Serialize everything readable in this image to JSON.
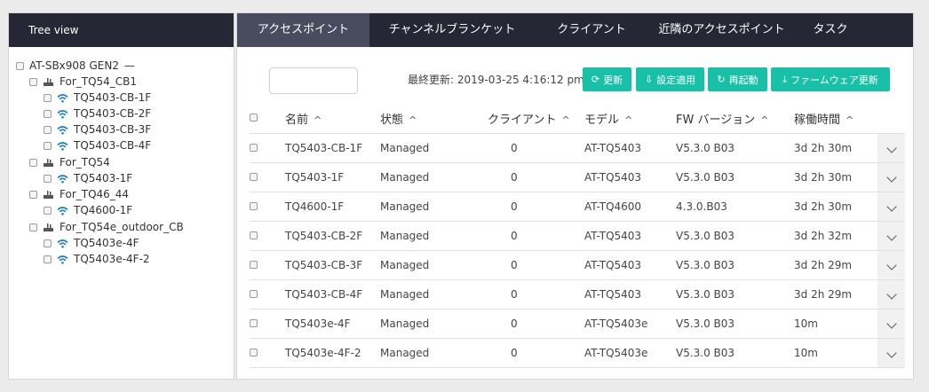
{
  "tree_panel": {
    "title": "Tree view",
    "nodes": [
      {
        "label": "AT-SBx908 GEN2",
        "suffix": "—",
        "type": "root"
      },
      {
        "label": "For_TQ54_CB1",
        "type": "switch"
      },
      {
        "label": "TQ5403-CB-1F",
        "type": "ap"
      },
      {
        "label": "TQ5403-CB-2F",
        "type": "ap"
      },
      {
        "label": "TQ5403-CB-3F",
        "type": "ap"
      },
      {
        "label": "TQ5403-CB-4F",
        "type": "ap"
      },
      {
        "label": "For_TQ54",
        "type": "switch"
      },
      {
        "label": "TQ5403-1F",
        "type": "ap"
      },
      {
        "label": "For_TQ46_44",
        "type": "switch"
      },
      {
        "label": "TQ4600-1F",
        "type": "ap"
      },
      {
        "label": "For_TQ54e_outdoor_CB",
        "type": "switch"
      },
      {
        "label": "TQ5403e-4F",
        "type": "ap"
      },
      {
        "label": "TQ5403e-4F-2",
        "type": "ap"
      }
    ]
  },
  "tabs": [
    {
      "label": "アクセスポイント",
      "active": true
    },
    {
      "label": "チャンネルブランケット",
      "active": false
    },
    {
      "label": "クライアント",
      "active": false
    },
    {
      "label": "近隣のアクセスポイント",
      "active": false
    },
    {
      "label": "タスク",
      "active": false
    }
  ],
  "toolbar": {
    "search_value": "",
    "last_updated": "最終更新: 2019-03-25 4:16:12 pm",
    "buttons": {
      "refresh": "更新",
      "apply_settings": "設定適用",
      "reboot": "再起動",
      "firmware_update": "ファームウェア更新"
    }
  },
  "table": {
    "columns": [
      "名前",
      "状態",
      "クライアント",
      "モデル",
      "FW バージョン",
      "稼働時間"
    ],
    "sort_indicator": "^",
    "rows": [
      {
        "name": "TQ5403-CB-1F",
        "status": "Managed",
        "clients": "0",
        "model": "AT-TQ5403",
        "fw": "V5.3.0 B03",
        "uptime": "3d 2h 30m"
      },
      {
        "name": "TQ5403-1F",
        "status": "Managed",
        "clients": "0",
        "model": "AT-TQ5403",
        "fw": "V5.3.0 B03",
        "uptime": "3d 2h 30m"
      },
      {
        "name": "TQ4600-1F",
        "status": "Managed",
        "clients": "0",
        "model": "AT-TQ4600",
        "fw": "4.3.0.B03",
        "uptime": "3d 2h 30m"
      },
      {
        "name": "TQ5403-CB-2F",
        "status": "Managed",
        "clients": "0",
        "model": "AT-TQ5403",
        "fw": "V5.3.0 B03",
        "uptime": "3d 2h 32m"
      },
      {
        "name": "TQ5403-CB-3F",
        "status": "Managed",
        "clients": "0",
        "model": "AT-TQ5403",
        "fw": "V5.3.0 B03",
        "uptime": "3d 2h 29m"
      },
      {
        "name": "TQ5403-CB-4F",
        "status": "Managed",
        "clients": "0",
        "model": "AT-TQ5403",
        "fw": "V5.3.0 B03",
        "uptime": "3d 2h 29m"
      },
      {
        "name": "TQ5403e-4F",
        "status": "Managed",
        "clients": "0",
        "model": "AT-TQ5403e",
        "fw": "V5.3.0 B03",
        "uptime": "10m"
      },
      {
        "name": "TQ5403e-4F-2",
        "status": "Managed",
        "clients": "0",
        "model": "AT-TQ5403e",
        "fw": "V5.3.0 B03",
        "uptime": "10m"
      }
    ]
  },
  "colors": {
    "header_bg": "#262735",
    "active_tab_bg": "#494b5f",
    "accent_button": "#18c0a8",
    "wifi_icon": "#1f7fc0"
  },
  "icons": {
    "ap": "wifi-icon",
    "switch": "switch-icon",
    "expand": "chevron-down-icon",
    "refresh": "refresh-icon",
    "apply": "apply-icon",
    "reboot": "reboot-icon",
    "firmware": "download-icon"
  }
}
